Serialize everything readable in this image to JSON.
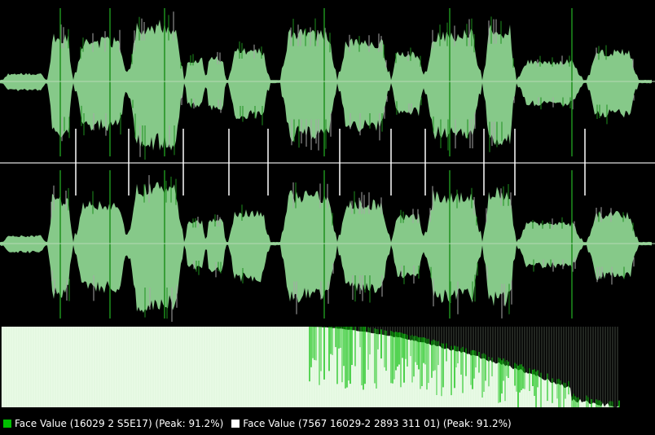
{
  "colors": {
    "background": "#000000",
    "wave_fill": "#86c989",
    "wave_spike": "#1e8f1e",
    "wave_gray": "#a7a7a7",
    "center_line": "#b5d9b5",
    "divider": "#8a8a8a",
    "marker": "#ffffff",
    "spectrum_fill": "#e9fbe6",
    "spectrum_peak": "#0ac00a"
  },
  "legend": [
    {
      "label": "Face Value (16029 2 S5E17) (Peak: 91.2%)",
      "color": "#00c000"
    },
    {
      "label": "Face Value (7567 16029-2 2893 311 01) (Peak: 91.2%)",
      "color": "#ffffff"
    }
  ]
}
